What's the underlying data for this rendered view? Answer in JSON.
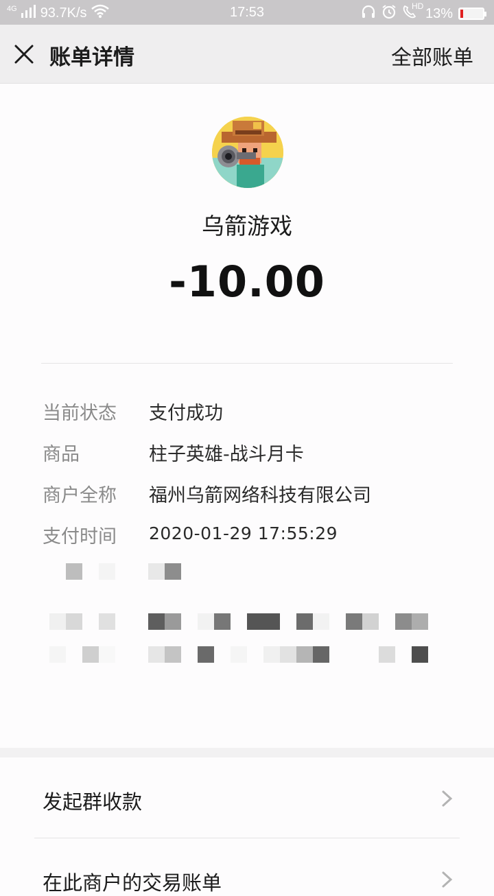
{
  "status_bar": {
    "network": "4G",
    "speed": "93.7K/s",
    "time": "17:53",
    "hd": "HD",
    "battery_percent": "13%",
    "battery_level": 0.13
  },
  "nav": {
    "title": "账单详情",
    "right_action": "全部账单"
  },
  "merchant": {
    "name": "乌箭游戏",
    "amount": "-10.00"
  },
  "details": [
    {
      "label": "当前状态",
      "value": "支付成功"
    },
    {
      "label": "商品",
      "value": "柱子英雄-战斗月卡"
    },
    {
      "label": "商户全称",
      "value": "福州乌箭网络科技有限公司"
    },
    {
      "label": "支付时间",
      "value": "2020-01-29 17:55:29"
    }
  ],
  "menu": [
    {
      "label": "发起群收款"
    },
    {
      "label": "在此商户的交易账单"
    }
  ],
  "colors": {
    "status_bar": "#c9c7c9",
    "nav_bar": "#efeeef",
    "background": "#fdfcfd",
    "label_gray": "#8a8a8a"
  },
  "icons": {
    "close": "close-icon",
    "chevron": "chevron-right-icon",
    "avatar": "merchant-avatar-cowboy"
  }
}
